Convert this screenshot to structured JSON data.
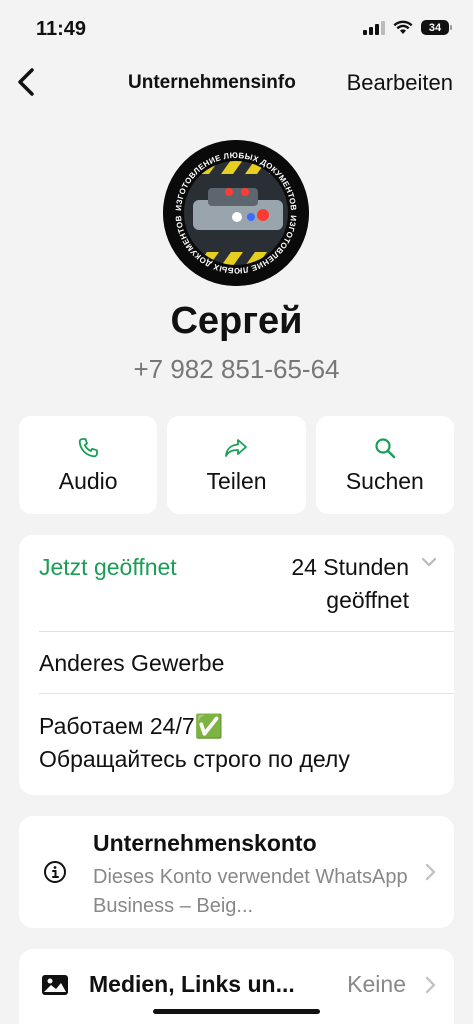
{
  "status_bar": {
    "time": "11:49",
    "battery": "34"
  },
  "nav": {
    "title": "Unternehmensinfo",
    "edit": "Bearbeiten"
  },
  "profile": {
    "name": "Сергей",
    "phone": "+7 982 851-65-64",
    "avatar_caption": "ИЗГОТОВЛЕНИЕ ЛЮБЫХ ДОКУМЕНТОВ"
  },
  "actions": [
    {
      "label": "Audio",
      "icon": "phone-icon"
    },
    {
      "label": "Teilen",
      "icon": "share-icon"
    },
    {
      "label": "Suchen",
      "icon": "search-icon"
    }
  ],
  "hours": {
    "status": "Jetzt geöffnet",
    "value": "24 Stunden geöffnet",
    "category": "Anderes Gewerbe",
    "description": "Работаем 24/7✅\nОбращайтесь строго по делу"
  },
  "account": {
    "title": "Unternehmenskonto",
    "subtitle": "Dieses Konto verwendet WhatsApp Business – Beig..."
  },
  "media": {
    "title": "Medien, Links un...",
    "value": "Keine"
  },
  "colors": {
    "accent_green": "#1a9e55",
    "background": "#f3f3f3",
    "card": "#ffffff"
  }
}
